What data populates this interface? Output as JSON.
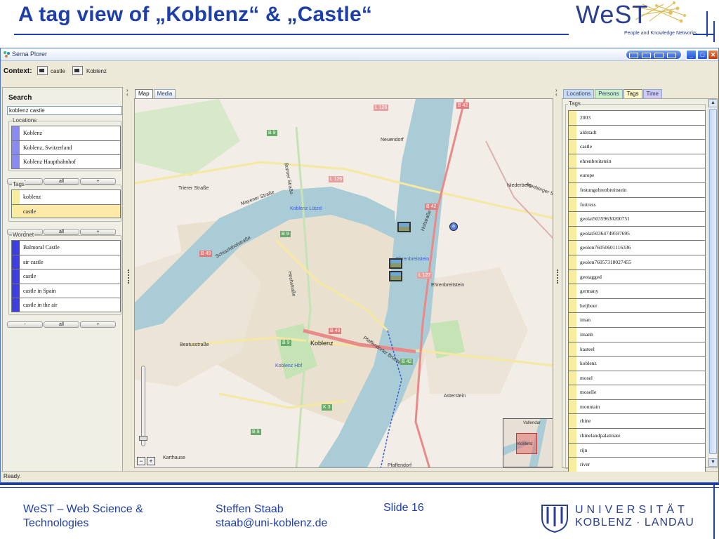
{
  "slide": {
    "title": "A tag view of „Koblenz“ & „Castle“",
    "logo_text": "WeST",
    "logo_subtitle": "People and Knowledge Networks"
  },
  "app": {
    "window_title": "Sema Plorer",
    "context_label": "Context:",
    "context_items": [
      "castle",
      "Koblenz"
    ],
    "status": "Ready."
  },
  "left": {
    "search_label": "Search",
    "search_value": "koblenz castle",
    "locations": {
      "title": "Locations",
      "items": [
        "Koblenz",
        "Koblenz, Switzerland",
        "Koblenz Hauptbahnhof"
      ],
      "bar_color": "#8a8af0"
    },
    "tags": {
      "title": "Tags",
      "items": [
        "koblenz",
        "castle"
      ],
      "selected": "castle",
      "bar_color": "#f6ed9e"
    },
    "wordnet": {
      "title": "Wordnet",
      "items": [
        "Balmoral Castle",
        "air castle",
        "castle",
        "castle in Spain",
        "castle in the air"
      ],
      "bar_color": "#3f3fe0"
    },
    "buttons": [
      "-",
      "all",
      "+"
    ]
  },
  "map": {
    "tabs": [
      "Map",
      "Media"
    ],
    "active_tab": "Map",
    "labels": {
      "city": "Koblenz",
      "luetzel": "Koblenz Lützel",
      "ehrenbreitstein_station": "Ehrenbreitstein",
      "ehrenbreitstein": "Ehrenbreitstein",
      "neuendorf": "Neuendorf",
      "niederberg": "Niederberg",
      "asterstein": "Asterstein",
      "hbf": "Koblenz Hbf",
      "karthause": "Karthause",
      "pfaffendorf": "Pfaffendorf",
      "vallendar": "Vallendar",
      "mini_koblenz": "Koblenz",
      "trierer": "Trierer Straße",
      "mayener": "Mayener Straße",
      "schlachthof": "Schlachthofstraße",
      "beatus": "Beatusstraße",
      "pfaffendorfer_bruecke": "Pfaffendorfer Brücke",
      "hofstrasse": "Hofstraße",
      "bonner": "Bonner Straße",
      "arenberger": "Arenberger Straße",
      "hochstrasse": "Hochstraße"
    },
    "shields": [
      "L 126",
      "B 42",
      "B 9",
      "L 126",
      "B 42",
      "B 9",
      "B 49",
      "L 127",
      "B 49",
      "B 9",
      "B 42",
      "K 3",
      "B 9"
    ],
    "marker_label": "a",
    "zoom_minus": "−",
    "zoom_plus": "+",
    "colors": {
      "river": "#a9ccd6",
      "urban": "#e9e0cf",
      "motorway": "#e98a8a",
      "primary": "#f5e8a0",
      "green": "#c6e3b5"
    }
  },
  "right": {
    "tabs": [
      "Locations",
      "Persons",
      "Tags",
      "Time"
    ],
    "active_tab": "Tags",
    "tags_title": "Tags",
    "tags": [
      "2003",
      "aldstadt",
      "castle",
      "ehrenbreitstein",
      "europe",
      "festungehrenbreitstein",
      "fortress",
      "geolat50359630200751",
      "geolat50364749597695",
      "geolon76050601116336",
      "geolon76057318027455",
      "geotagged",
      "germany",
      "heijboer",
      "iman",
      "imanh",
      "kasteel",
      "koblenz",
      "mosel",
      "moselle",
      "mountain",
      "rhine",
      "rhinelandpalatinate",
      "rijn",
      "river"
    ]
  },
  "footer": {
    "left_line1": "WeST – Web Science &",
    "left_line2": "Technologies",
    "author": "Steffen Staab",
    "email": "staab@uni-koblenz.de",
    "slide_label": "Slide 16",
    "uni_line1": "UNIVERSITÄT",
    "uni_line2": "KOBLENZ · LANDAU"
  }
}
